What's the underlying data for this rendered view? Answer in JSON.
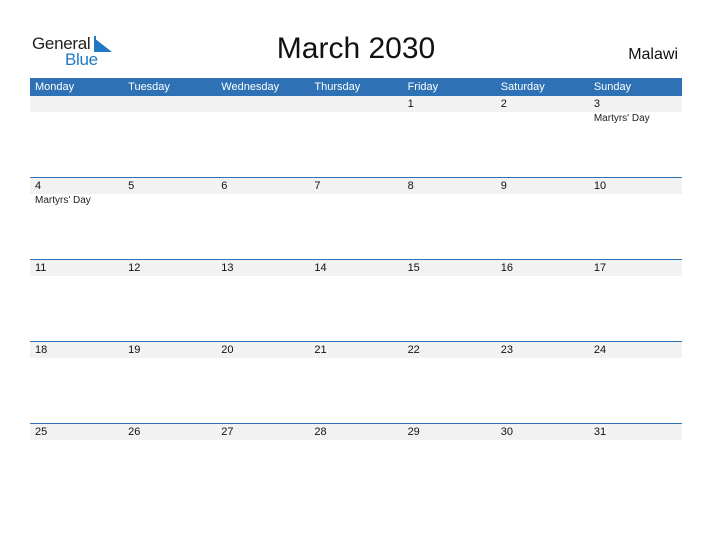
{
  "logo": {
    "word1": "General",
    "word2": "Blue",
    "accent": "#1f78c1"
  },
  "title": "March 2030",
  "country": "Malawi",
  "colors": {
    "header_bg": "#2e72b5",
    "date_strip": "#f2f2f2"
  },
  "weekdays": [
    "Monday",
    "Tuesday",
    "Wednesday",
    "Thursday",
    "Friday",
    "Saturday",
    "Sunday"
  ],
  "weeks": [
    [
      {
        "day": "",
        "event": ""
      },
      {
        "day": "",
        "event": ""
      },
      {
        "day": "",
        "event": ""
      },
      {
        "day": "",
        "event": ""
      },
      {
        "day": "1",
        "event": ""
      },
      {
        "day": "2",
        "event": ""
      },
      {
        "day": "3",
        "event": "Martyrs' Day"
      }
    ],
    [
      {
        "day": "4",
        "event": "Martyrs' Day"
      },
      {
        "day": "5",
        "event": ""
      },
      {
        "day": "6",
        "event": ""
      },
      {
        "day": "7",
        "event": ""
      },
      {
        "day": "8",
        "event": ""
      },
      {
        "day": "9",
        "event": ""
      },
      {
        "day": "10",
        "event": ""
      }
    ],
    [
      {
        "day": "11",
        "event": ""
      },
      {
        "day": "12",
        "event": ""
      },
      {
        "day": "13",
        "event": ""
      },
      {
        "day": "14",
        "event": ""
      },
      {
        "day": "15",
        "event": ""
      },
      {
        "day": "16",
        "event": ""
      },
      {
        "day": "17",
        "event": ""
      }
    ],
    [
      {
        "day": "18",
        "event": ""
      },
      {
        "day": "19",
        "event": ""
      },
      {
        "day": "20",
        "event": ""
      },
      {
        "day": "21",
        "event": ""
      },
      {
        "day": "22",
        "event": ""
      },
      {
        "day": "23",
        "event": ""
      },
      {
        "day": "24",
        "event": ""
      }
    ],
    [
      {
        "day": "25",
        "event": ""
      },
      {
        "day": "26",
        "event": ""
      },
      {
        "day": "27",
        "event": ""
      },
      {
        "day": "28",
        "event": ""
      },
      {
        "day": "29",
        "event": ""
      },
      {
        "day": "30",
        "event": ""
      },
      {
        "day": "31",
        "event": ""
      }
    ]
  ]
}
